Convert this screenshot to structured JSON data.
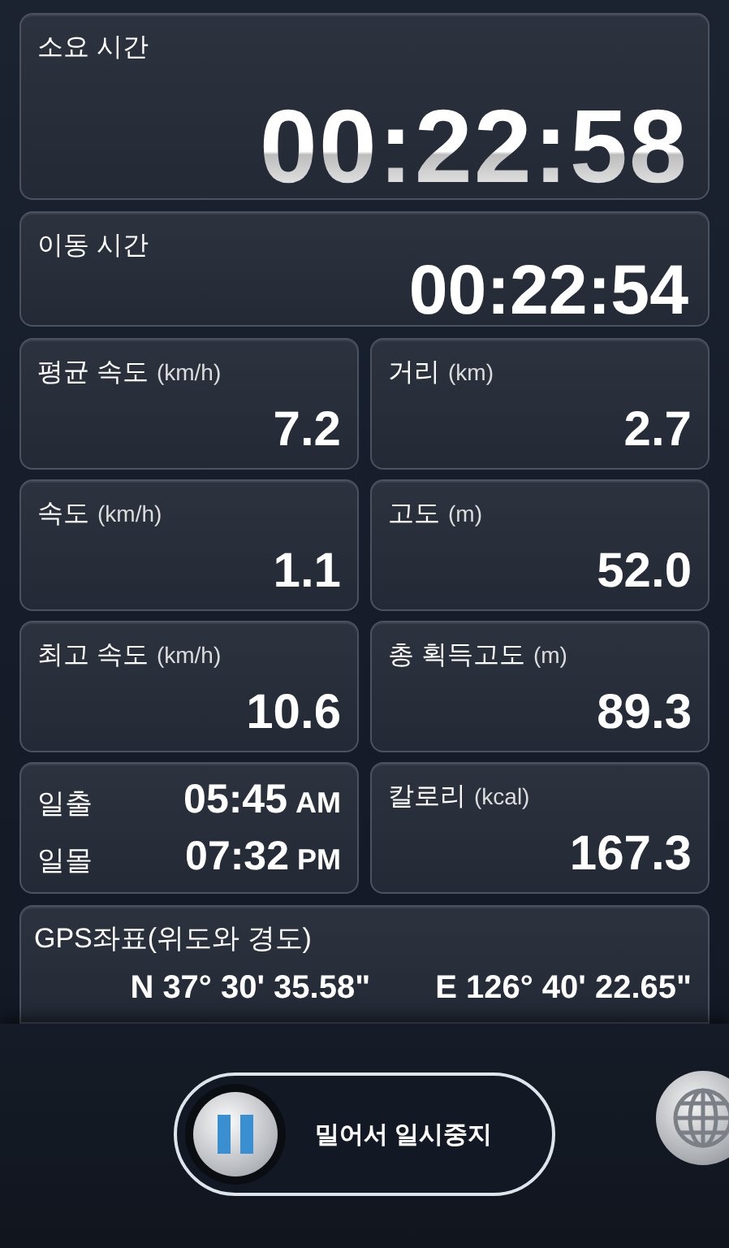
{
  "total_time": {
    "label": "소요 시간",
    "value": "00:22:58"
  },
  "moving_time": {
    "label": "이동 시간",
    "value": "00:22:54"
  },
  "grid": [
    {
      "kind": "stat",
      "label": "평균 속도",
      "unit": "(km/h)",
      "value": "7.2"
    },
    {
      "kind": "stat",
      "label": "거리",
      "unit": "(km)",
      "value": "2.7"
    },
    {
      "kind": "stat",
      "label": "속도",
      "unit": "(km/h)",
      "value": "1.1"
    },
    {
      "kind": "stat",
      "label": "고도",
      "unit": "(m)",
      "value": "52.0"
    },
    {
      "kind": "stat",
      "label": "최고 속도",
      "unit": "(km/h)",
      "value": "10.6"
    },
    {
      "kind": "stat",
      "label": "총 획득고도",
      "unit": "(m)",
      "value": "89.3"
    },
    {
      "kind": "sun",
      "rows": [
        {
          "label": "일출",
          "time": "05:45",
          "period": "AM"
        },
        {
          "label": "일몰",
          "time": "07:32",
          "period": "PM"
        }
      ]
    },
    {
      "kind": "stat",
      "label": "칼로리",
      "unit": "(kcal)",
      "value": "167.3"
    }
  ],
  "gps": {
    "label": "GPS좌표(위도와 경도)",
    "latitude": "N 37° 30' 35.58\"",
    "longitude": "E 126° 40' 22.65\""
  },
  "pause_slider": {
    "label": "밀어서 일시중지",
    "level": 0
  }
}
